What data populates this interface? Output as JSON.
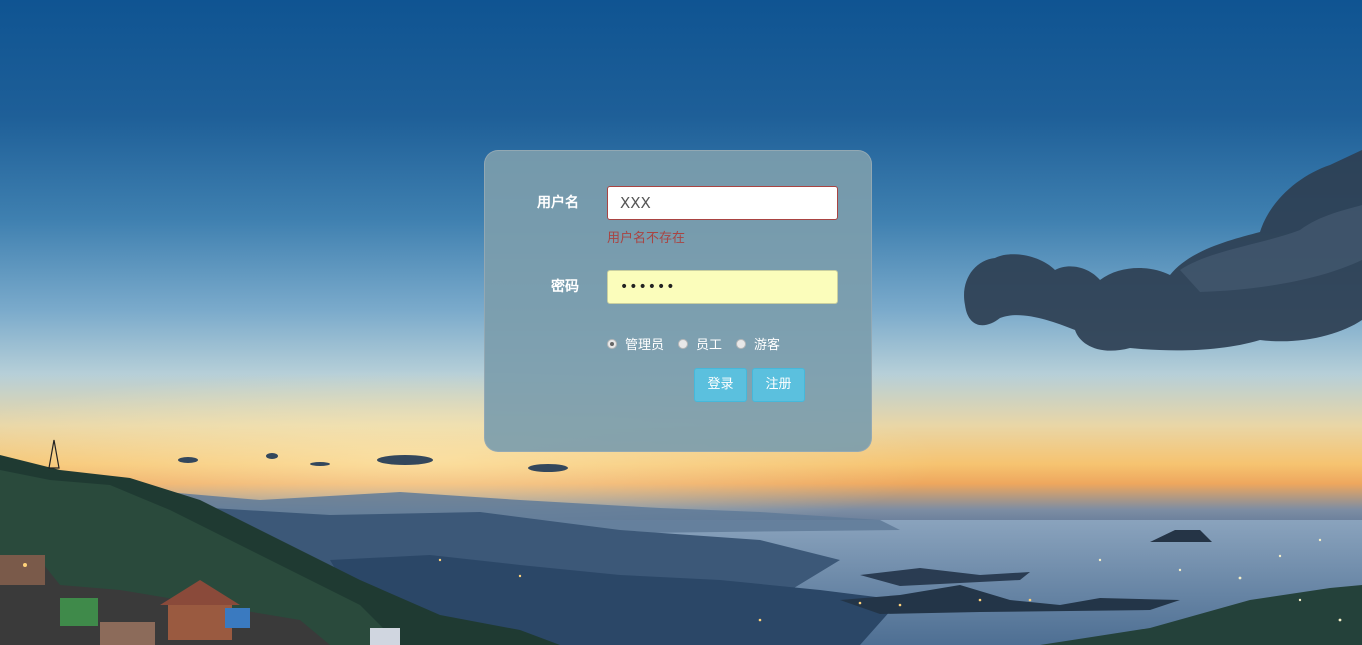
{
  "login": {
    "username_label": "用户名",
    "username_value": "XXX",
    "username_error": "用户名不存在",
    "password_label": "密码",
    "password_value": "••••••",
    "roles": [
      {
        "label": "管理员",
        "checked": true
      },
      {
        "label": "员工",
        "checked": false
      },
      {
        "label": "游客",
        "checked": false
      }
    ],
    "login_button": "登录",
    "register_button": "注册"
  },
  "colors": {
    "panel": "#7c9dac",
    "error": "#a94442",
    "button": "#5bc0de",
    "password_fill": "#fbfdbb"
  }
}
